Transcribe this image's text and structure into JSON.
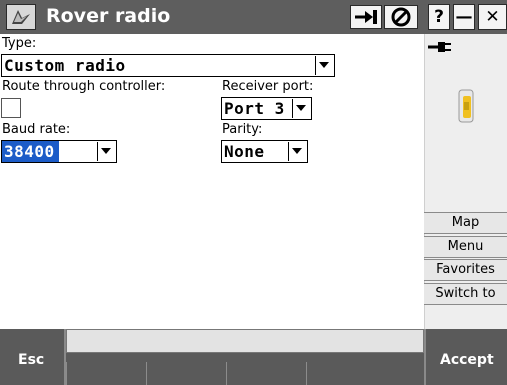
{
  "window": {
    "title": "Rover radio",
    "buttons": [
      "?",
      "—",
      "✕"
    ]
  },
  "form": {
    "type_label": "Type:",
    "type_value": "Custom radio",
    "route_label": "Route through controller:",
    "route_checked": false,
    "receiver_port_label": "Receiver port:",
    "receiver_port_value": "Port 3",
    "baud_rate_label": "Baud rate:",
    "baud_rate_value": "38400",
    "parity_label": "Parity:",
    "parity_value": "None"
  },
  "right_panel": {
    "icons": [
      "cable-plug-icon",
      "receiver-device-icon"
    ],
    "buttons": [
      "Map",
      "Menu",
      "Favorites",
      "Switch to"
    ]
  },
  "bottom": {
    "esc_label": "Esc",
    "accept_label": "Accept"
  },
  "colors": {
    "titlebar": "#5e5e5e",
    "selection": "#1c5cc8",
    "receiver_yellow": "#f0c020"
  }
}
